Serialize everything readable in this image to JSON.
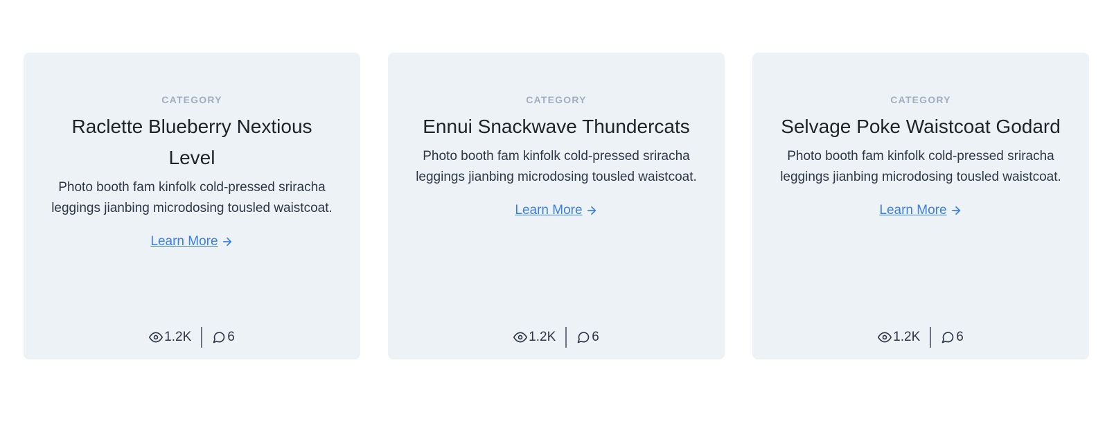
{
  "cards": [
    {
      "category": "CATEGORY",
      "title": "Raclette Blueberry Nextious Level",
      "description": "Photo booth fam kinfolk cold-pressed sriracha leggings jianbing microdosing tousled waistcoat.",
      "link_label": "Learn More",
      "views": "1.2K",
      "comments": "6"
    },
    {
      "category": "CATEGORY",
      "title": "Ennui Snackwave Thundercats",
      "description": "Photo booth fam kinfolk cold-pressed sriracha leggings jianbing microdosing tousled waistcoat.",
      "link_label": "Learn More",
      "views": "1.2K",
      "comments": "6"
    },
    {
      "category": "CATEGORY",
      "title": "Selvage Poke Waistcoat Godard",
      "description": "Photo booth fam kinfolk cold-pressed sriracha leggings jianbing microdosing tousled waistcoat.",
      "link_label": "Learn More",
      "views": "1.2K",
      "comments": "6"
    }
  ],
  "icons": {
    "views": "eye-icon",
    "comments": "chat-bubble-icon",
    "link": "arrow-right-icon"
  },
  "colors": {
    "card_background": "#edf2f7",
    "link": "#3b7fe0",
    "category": "#a0aec0"
  }
}
